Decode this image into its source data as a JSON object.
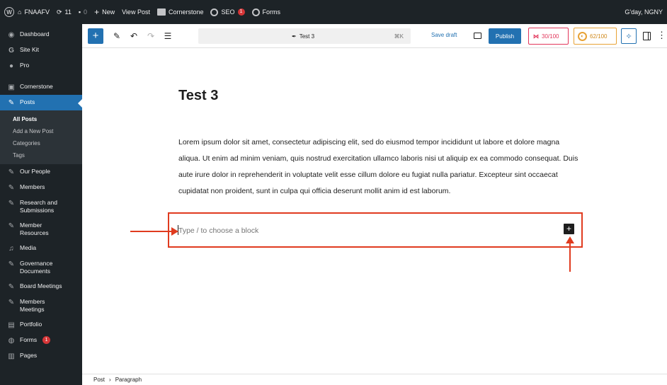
{
  "admin_bar": {
    "site_name": "FNAAFV",
    "updates_count": "11",
    "comments_count": "0",
    "new_label": "New",
    "view_post_label": "View Post",
    "cornerstone_label": "Cornerstone",
    "seo_label": "SEO",
    "seo_badge": "1",
    "forms_label": "Forms",
    "greeting": "G'day, NGNY"
  },
  "sidebar": {
    "items_top": [
      {
        "label": "Dashboard",
        "icon": "dashboard-icon"
      },
      {
        "label": "Site Kit",
        "icon": "sitekit-icon"
      },
      {
        "label": "Pro",
        "icon": "pro-icon"
      }
    ],
    "cornerstone": "Cornerstone",
    "posts": "Posts",
    "submenu": [
      "All Posts",
      "Add a New Post",
      "Categories",
      "Tags"
    ],
    "items_bottom": [
      {
        "label": "Our People"
      },
      {
        "label": "Members"
      },
      {
        "label": "Research and Submissions"
      },
      {
        "label": "Member Resources"
      },
      {
        "label": "Media"
      },
      {
        "label": "Governance Documents"
      },
      {
        "label": "Board Meetings"
      },
      {
        "label": "Members Meetings"
      },
      {
        "label": "Portfolio"
      },
      {
        "label": "Forms",
        "badge": "1"
      },
      {
        "label": "Pages"
      }
    ]
  },
  "toolbar": {
    "doc_title": "Test 3",
    "shortcut": "⌘K",
    "save_draft": "Save draft",
    "publish": "Publish",
    "seo_score": "30/100",
    "readability_score": "62/100"
  },
  "editor": {
    "title": "Test 3",
    "paragraph": "Lorem ipsum dolor sit amet, consectetur adipiscing elit, sed do eiusmod tempor incididunt ut labore et dolore magna aliqua. Ut enim ad minim veniam, quis nostrud exercitation ullamco laboris nisi ut aliquip ex ea commodo consequat. Duis aute irure dolor in reprehenderit in voluptate velit esse cillum dolore eu fugiat nulla pariatur. Excepteur sint occaecat cupidatat non proident, sunt in culpa qui officia deserunt mollit anim id est laborum.",
    "placeholder": "Type / to choose a block"
  },
  "breadcrumb": {
    "post": "Post",
    "separator": "›",
    "current": "Paragraph"
  },
  "colors": {
    "admin_bg": "#1d2327",
    "accent": "#2271b1",
    "annotation": "#e03b1f"
  }
}
